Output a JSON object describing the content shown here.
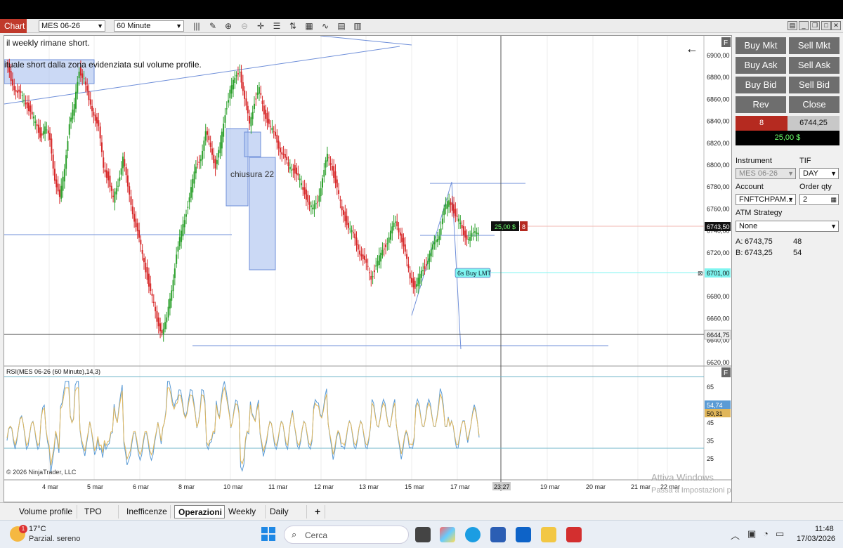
{
  "toolbar": {
    "tab_label": "Chart",
    "instrument": "MES 06-26",
    "interval": "60 Minute"
  },
  "chart": {
    "note_line1": "il weekly rimane short.",
    "note_line2": "ituale short dalla zona evidenziata sul volume profile.",
    "box_label": "chiusura 22",
    "pnl_badge": "25,00 $",
    "position_qty": "8",
    "order_label": "6s Buy LMT",
    "price_axis": [
      "6900,00",
      "6880,00",
      "6860,00",
      "6840,00",
      "6820,00",
      "6800,00",
      "6780,00",
      "6760,00",
      "6740,00",
      "6720,00",
      "6700,00",
      "6680,00",
      "6660,00",
      "6640,00",
      "6620,00"
    ],
    "last_price_tag": "6743,50",
    "order_price_tag": "6701,00",
    "low_price_tag": "6644,75",
    "copyright": "© 2026 NinjaTrader, LLC",
    "rsi_label": "RSI(MES 06-26 (60 Minute),14,3)",
    "rsi_axis": [
      "65",
      "55",
      "45",
      "35",
      "25"
    ],
    "rsi_value1": "54,74",
    "rsi_value2": "50,31",
    "date_axis": [
      "4 mar",
      "5 mar",
      "6 mar",
      "8 mar",
      "10 mar",
      "11 mar",
      "12 mar",
      "13 mar",
      "15 mar",
      "17 mar",
      "23:27",
      "19 mar",
      "20 mar",
      "21 mar",
      "22 mar"
    ],
    "watermark1": "Attiva Windows",
    "watermark2": "Passa a Impostazioni per attivare Windows.",
    "panel_flag": "F"
  },
  "order_panel": {
    "buy_mkt": "Buy Mkt",
    "sell_mkt": "Sell Mkt",
    "buy_ask": "Buy Ask",
    "sell_ask": "Sell Ask",
    "buy_bid": "Buy Bid",
    "sell_bid": "Sell Bid",
    "rev": "Rev",
    "close": "Close",
    "position": "8",
    "avg_price": "6744,25",
    "unrealized": "25,00 $",
    "instrument_label": "Instrument",
    "tif_label": "TIF",
    "instrument_value": "MES 06-26",
    "tif_value": "DAY",
    "account_label": "Account",
    "qty_label": "Order qty",
    "account_value": "FNFTCHPAM...",
    "qty_value": "2",
    "atm_label": "ATM Strategy",
    "atm_value": "None",
    "ask_label": "A:",
    "ask_price": "6743,75",
    "ask_size": "48",
    "bid_label": "B:",
    "bid_price": "6743,25",
    "bid_size": "54"
  },
  "tabs": [
    "Volume profile",
    "TPO",
    "Inefficenze",
    "Operazioni",
    "Weekly",
    "Daily RTH"
  ],
  "active_tab": "Operazioni",
  "taskbar": {
    "weather_temp": "17°C",
    "weather_desc": "Parzial. sereno",
    "weather_badge": "1",
    "search_placeholder": "Cerca",
    "time": "11:48",
    "date": "17/03/2026"
  },
  "colors": {
    "up": "#2ca02c",
    "down": "#d62728",
    "order_tag": "#7ff5f0",
    "position_red": "#b52a20"
  },
  "series": {
    "price_path_1": [
      6895,
      6880,
      6870,
      6865,
      6860,
      6850,
      6840,
      6830,
      6835,
      6825,
      6790,
      6770,
      6800,
      6840,
      6855,
      6890,
      6880,
      6860,
      6850,
      6835,
      6800,
      6790,
      6770,
      6785,
      6810,
      6780,
      6760,
      6740,
      6720,
      6700,
      6680,
      6660,
      6650,
      6660,
      6690,
      6720,
      6740,
      6760,
      6780,
      6800,
      6810,
      6830,
      6820,
      6800,
      6820,
      6850,
      6870,
      6880,
      6890,
      6860,
      6840,
      6860,
      6870,
      6850,
      6840,
      6830,
      6820,
      6810,
      6800,
      6800,
      6790,
      6780,
      6770,
      6760,
      6770,
      6790,
      6810,
      6800,
      6780,
      6760,
      6750,
      6740,
      6730,
      6720,
      6710,
      6700,
      6710,
      6720,
      6730,
      6740,
      6750,
      6740,
      6720,
      6700,
      6690,
      6700,
      6710,
      6720,
      6730,
      6740,
      6760,
      6770,
      6760,
      6750,
      6740,
      6735,
      6738,
      6743
    ]
  }
}
